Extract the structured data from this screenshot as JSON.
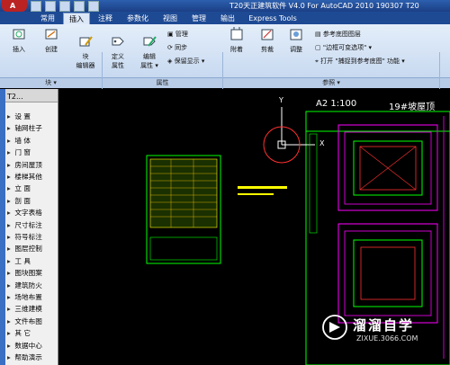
{
  "window": {
    "title": "T20天正建筑软件 V4.0 For AutoCAD 2010  190307 T20"
  },
  "ribbon": {
    "tabs": [
      "常用",
      "插入",
      "注释",
      "参数化",
      "视图",
      "管理",
      "输出",
      "Express Tools"
    ],
    "active_tab": "插入",
    "block_panel": {
      "title": "块 ▾",
      "buttons": [
        "插入",
        "创建",
        "块\n编辑器"
      ]
    },
    "attr_panel": {
      "title": "属性",
      "buttons": [
        "定义\n属性",
        "编辑\n属性 ▾"
      ],
      "small": [
        "管理",
        "同步",
        "保留显示 ▾"
      ]
    },
    "ref_panel": {
      "title": "参照 ▾",
      "buttons": [
        "附着",
        "剪裁",
        "调整"
      ],
      "small": [
        "参考底图图层",
        "\"边框可变选项\" ▾",
        "打开  \"捕捉到参考底图\" 功能 ▾"
      ]
    }
  },
  "palette": {
    "title": "T2...",
    "items": [
      "设    置",
      "轴网柱子",
      "墙    体",
      "门    窗",
      "房间屋顶",
      "楼梯其他",
      "立    面",
      "剖    面",
      "文字表格",
      "尺寸标注",
      "符号标注",
      "图层控制",
      "工    具",
      "图块图案",
      "建筑防火",
      "场地布置",
      "三维建模",
      "文件布图",
      "其    它",
      "数据中心",
      "帮助演示"
    ]
  },
  "drawing": {
    "title_left": "A2  1:100",
    "title_right": "19#坡屋顶",
    "ucs_y": "Y",
    "ucs_x": "X"
  },
  "watermark": {
    "name": "溜溜自学",
    "url": "ZIXUE.3066.COM"
  },
  "colors": {
    "titlebar": "#1b3f86",
    "ribbon": "#dce8f7",
    "canvas": "#000000",
    "drawing_green": "#00ff00",
    "drawing_magenta": "#ff00ff",
    "drawing_yellow": "#ffff00"
  }
}
